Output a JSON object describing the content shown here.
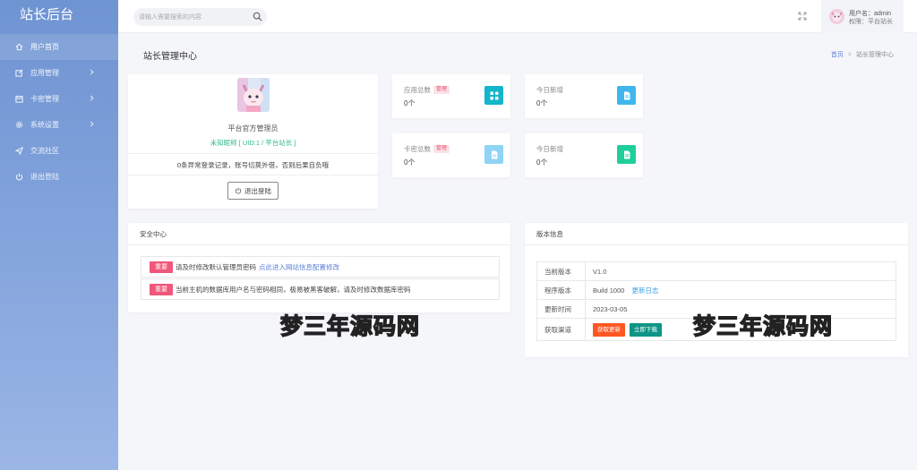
{
  "sidebar": {
    "brand": "站长后台",
    "items": [
      {
        "label": "用户首页",
        "icon": "home-icon"
      },
      {
        "label": "应用管理",
        "icon": "edit-icon"
      },
      {
        "label": "卡密管理",
        "icon": "calendar-icon"
      },
      {
        "label": "系统设置",
        "icon": "gear-icon"
      },
      {
        "label": "交流社区",
        "icon": "send-icon"
      },
      {
        "label": "退出登陆",
        "icon": "power-icon"
      }
    ]
  },
  "header": {
    "search_placeholder": "请输入需要搜索的内容",
    "user_line1": "用户名：admin",
    "user_line2": "权限：平台站长"
  },
  "page": {
    "title": "站长管理中心",
    "breadcrumb_home": "首页",
    "breadcrumb_sep": ">",
    "breadcrumb_current": "站长管理中心"
  },
  "profile": {
    "name": "平台官方管理员",
    "nickname": "未知昵称 [ UID:1 / 平台站长 ]",
    "notice": "0条异常登录记录，账号切莫外借，否则后果自负哦",
    "logout_label": "退出登陆"
  },
  "stats": [
    {
      "label": "应用总数",
      "badge": "管理",
      "value": "0个",
      "icon_color": "#12b5cb"
    },
    {
      "label": "今日新增",
      "badge": "",
      "value": "0个",
      "icon_color": "#3fb6ec"
    },
    {
      "label": "卡密总数",
      "badge": "管理",
      "value": "0个",
      "icon_color": "#8fd3f5"
    },
    {
      "label": "今日新增",
      "badge": "",
      "value": "0个",
      "icon_color": "#1fcf9b"
    }
  ],
  "security": {
    "title": "安全中心",
    "alerts": [
      {
        "tag": "重要",
        "text": "请及时修改默认管理员密码",
        "link": "点此进入网站信息配置修改"
      },
      {
        "tag": "重要",
        "text": "当前主机的数据库用户名与密码相同，极易被黑客破解，请及时修改数据库密码",
        "link": ""
      }
    ]
  },
  "version": {
    "title": "版本信息",
    "rows": [
      {
        "k": "当前版本",
        "v": "V1.0"
      },
      {
        "k": "程序版本",
        "v": "Build 1000",
        "extra": "更新日志"
      },
      {
        "k": "更新时间",
        "v": "2023-03-05"
      },
      {
        "k": "获取渠道",
        "btn1": "获取更新",
        "btn2": "立即下载"
      }
    ]
  },
  "watermark": "梦三年源码网",
  "colors": {
    "accent": "#6f94d2",
    "danger": "#f0577a",
    "success": "#2fb985",
    "link": "#5b7fd6"
  }
}
